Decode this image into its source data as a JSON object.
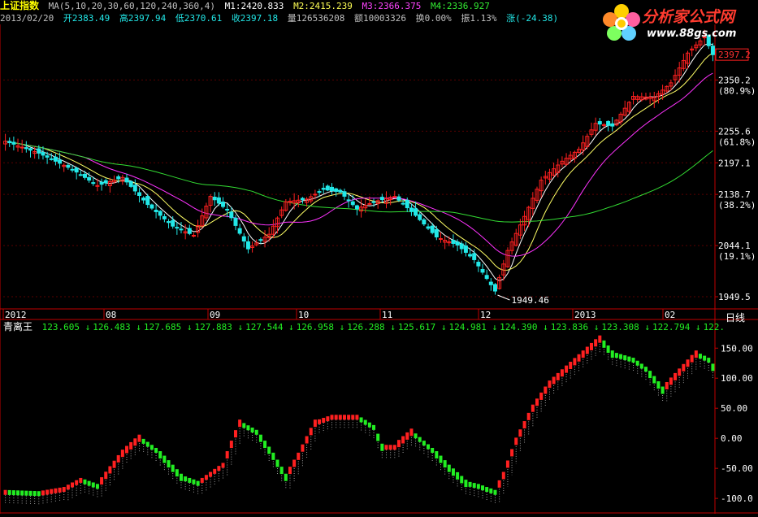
{
  "header": {
    "title": "上证指数",
    "ma_params": "MA(5,10,20,30,60,120,240,360,4)",
    "ma1": "M1:2420.833",
    "ma2": "M2:2415.239",
    "ma3": "M3:2366.375",
    "ma4": "M4:2336.927",
    "date": "2013/02/20",
    "open": "开2383.49",
    "high": "高2397.94",
    "low": "低2370.61",
    "close": "收2397.18",
    "volume": "量126536208",
    "amount": "额10003326",
    "turnover": "换0.00%",
    "amplitude": "振1.13%",
    "change": "涨(-24.38)"
  },
  "indicator_header": {
    "name": "青离王",
    "values": [
      "123.605",
      "126.483",
      "127.685",
      "127.883",
      "127.544",
      "126.958",
      "126.288",
      "125.617",
      "124.981",
      "124.390",
      "123.836",
      "123.308",
      "122.794",
      "122."
    ]
  },
  "period_label": "日线",
  "logo": {
    "brand": "分析家公式网",
    "url": "www.88gs.com"
  },
  "colors": {
    "up": "#ff2020",
    "down": "#22e8e8",
    "bull": "#ff2020",
    "bear": "#22ee22",
    "axis": "#c00000",
    "ma5": "#ffffff",
    "ma10": "#ffff66",
    "ma20": "#ff33ff",
    "ma60": "#33dd33"
  },
  "chart_data": [
    {
      "type": "candlestick",
      "y_ticks": [
        "2350.2",
        "(80.9%)",
        "2255.6",
        "(61.8%)",
        "2197.1",
        "2138.7",
        "(38.2%)",
        "2044.1",
        "(19.1%)",
        "1949.5"
      ],
      "y_tick_values": [
        2350.2,
        2255.6,
        2197.1,
        2138.7,
        2044.1,
        1949.5
      ],
      "last_price": "2397.2",
      "low_annotation": "1949.46",
      "x_ticks": [
        "2012",
        "08",
        "09",
        "10",
        "11",
        "12",
        "2013",
        "02"
      ],
      "ylim": [
        1930,
        2450
      ],
      "anchors": [
        {
          "i": 0,
          "v": 2237
        },
        {
          "i": 8,
          "v": 2215
        },
        {
          "i": 16,
          "v": 2185
        },
        {
          "i": 22,
          "v": 2155
        },
        {
          "i": 28,
          "v": 2170
        },
        {
          "i": 34,
          "v": 2120
        },
        {
          "i": 40,
          "v": 2080
        },
        {
          "i": 45,
          "v": 2063
        },
        {
          "i": 49,
          "v": 2135
        },
        {
          "i": 53,
          "v": 2110
        },
        {
          "i": 58,
          "v": 2038
        },
        {
          "i": 63,
          "v": 2065
        },
        {
          "i": 67,
          "v": 2125
        },
        {
          "i": 72,
          "v": 2130
        },
        {
          "i": 76,
          "v": 2148
        },
        {
          "i": 80,
          "v": 2143
        },
        {
          "i": 84,
          "v": 2112
        },
        {
          "i": 88,
          "v": 2125
        },
        {
          "i": 93,
          "v": 2135
        },
        {
          "i": 98,
          "v": 2100
        },
        {
          "i": 103,
          "v": 2060
        },
        {
          "i": 108,
          "v": 2045
        },
        {
          "i": 112,
          "v": 2018
        },
        {
          "i": 117,
          "v": 1960
        },
        {
          "i": 120,
          "v": 2035
        },
        {
          "i": 124,
          "v": 2098
        },
        {
          "i": 128,
          "v": 2165
        },
        {
          "i": 133,
          "v": 2200
        },
        {
          "i": 137,
          "v": 2222
        },
        {
          "i": 141,
          "v": 2270
        },
        {
          "i": 145,
          "v": 2265
        },
        {
          "i": 150,
          "v": 2320
        },
        {
          "i": 155,
          "v": 2318
        },
        {
          "i": 159,
          "v": 2345
        },
        {
          "i": 163,
          "v": 2400
        },
        {
          "i": 167,
          "v": 2430
        },
        {
          "i": 169,
          "v": 2397
        }
      ]
    },
    {
      "type": "bar",
      "name": "青离王",
      "y_ticks": [
        "150.00",
        "100.00",
        "50.00",
        "0.00",
        "-50.00",
        "-100.0"
      ],
      "y_tick_values": [
        150,
        100,
        50,
        0,
        -50,
        -100
      ],
      "ylim": [
        -112,
        172
      ],
      "anchors": [
        {
          "i": 0,
          "v": -90
        },
        {
          "i": 8,
          "v": -92
        },
        {
          "i": 14,
          "v": -85
        },
        {
          "i": 18,
          "v": -70
        },
        {
          "i": 22,
          "v": -80
        },
        {
          "i": 28,
          "v": -25
        },
        {
          "i": 32,
          "v": 0
        },
        {
          "i": 36,
          "v": -20
        },
        {
          "i": 42,
          "v": -65
        },
        {
          "i": 46,
          "v": -75
        },
        {
          "i": 52,
          "v": -45
        },
        {
          "i": 56,
          "v": 25
        },
        {
          "i": 60,
          "v": 10
        },
        {
          "i": 64,
          "v": -30
        },
        {
          "i": 67,
          "v": -65
        },
        {
          "i": 70,
          "v": -30
        },
        {
          "i": 74,
          "v": 25
        },
        {
          "i": 78,
          "v": 35
        },
        {
          "i": 84,
          "v": 35
        },
        {
          "i": 88,
          "v": 18
        },
        {
          "i": 90,
          "v": -15
        },
        {
          "i": 93,
          "v": -15
        },
        {
          "i": 97,
          "v": 10
        },
        {
          "i": 102,
          "v": -20
        },
        {
          "i": 106,
          "v": -50
        },
        {
          "i": 110,
          "v": -75
        },
        {
          "i": 113,
          "v": -80
        },
        {
          "i": 117,
          "v": -90
        },
        {
          "i": 119,
          "v": -62
        },
        {
          "i": 122,
          "v": -5
        },
        {
          "i": 126,
          "v": 50
        },
        {
          "i": 130,
          "v": 90
        },
        {
          "i": 134,
          "v": 115
        },
        {
          "i": 138,
          "v": 140
        },
        {
          "i": 142,
          "v": 165
        },
        {
          "i": 145,
          "v": 140
        },
        {
          "i": 150,
          "v": 130
        },
        {
          "i": 153,
          "v": 115
        },
        {
          "i": 157,
          "v": 80
        },
        {
          "i": 161,
          "v": 110
        },
        {
          "i": 165,
          "v": 140
        },
        {
          "i": 168,
          "v": 130
        },
        {
          "i": 169,
          "v": 118
        }
      ]
    }
  ]
}
